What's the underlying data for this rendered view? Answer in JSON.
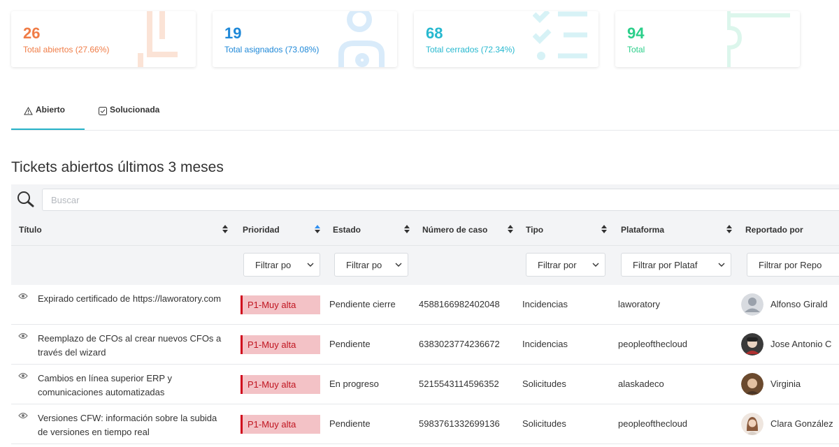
{
  "stats": [
    {
      "value": "26",
      "label": "Total abiertos (27.66%)",
      "color": "#f07c46"
    },
    {
      "value": "19",
      "label": "Total asignados (73.08%)",
      "color": "#1e88d8"
    },
    {
      "value": "68",
      "label": "Total cerrados (72.34%)",
      "color": "#26b8cf"
    },
    {
      "value": "94",
      "label": "Total",
      "color": "#2bcf8a"
    }
  ],
  "tabs": [
    {
      "label": "Abierto",
      "icon": "warning-icon",
      "active": true
    },
    {
      "label": "Solucionada",
      "icon": "checkbox-icon",
      "active": false
    }
  ],
  "section_title": "Tickets abiertos últimos 3 meses",
  "search": {
    "placeholder": "Buscar",
    "icon": "search-icon"
  },
  "columns": [
    {
      "label": "Título"
    },
    {
      "label": "Prioridad"
    },
    {
      "label": "Estado"
    },
    {
      "label": "Número de caso"
    },
    {
      "label": "Tipo"
    },
    {
      "label": "Plataforma"
    },
    {
      "label": "Reportado por"
    }
  ],
  "filters": {
    "prioridad": "Filtrar po",
    "estado": "Filtrar po",
    "tipo": "Filtrar por",
    "plataforma": "Filtrar por Plataf",
    "reportado": "Filtrar por Repo"
  },
  "rows": [
    {
      "title": "Expirado certificado de https://laworatory.com",
      "priority": "P1-Muy alta",
      "status": "Pendiente cierre",
      "case": "4588166982402048",
      "type": "Incidencias",
      "platform": "laworatory",
      "reporter": "Alfonso Girald"
    },
    {
      "title": "Reemplazo de CFOs al crear nuevos CFOs a través del wizard",
      "priority": "P1-Muy alta",
      "status": "Pendiente",
      "case": "6383023774236672",
      "type": "Incidencias",
      "platform": "peopleofthecloud",
      "reporter": "Jose Antonio C"
    },
    {
      "title": "Cambios en línea superior ERP y comunicaciones automatizadas",
      "priority": "P1-Muy alta",
      "status": "En progreso",
      "case": "5215543114596352",
      "type": "Solicitudes",
      "platform": "alaskadeco",
      "reporter": "Virginia"
    },
    {
      "title": "Versiones CFW: información sobre la subida de versiones en tiempo real",
      "priority": "P1-Muy alta",
      "status": "Pendiente",
      "case": "5983761332699136",
      "type": "Solicitudes",
      "platform": "peopleofthecloud",
      "reporter": "Clara González"
    }
  ]
}
